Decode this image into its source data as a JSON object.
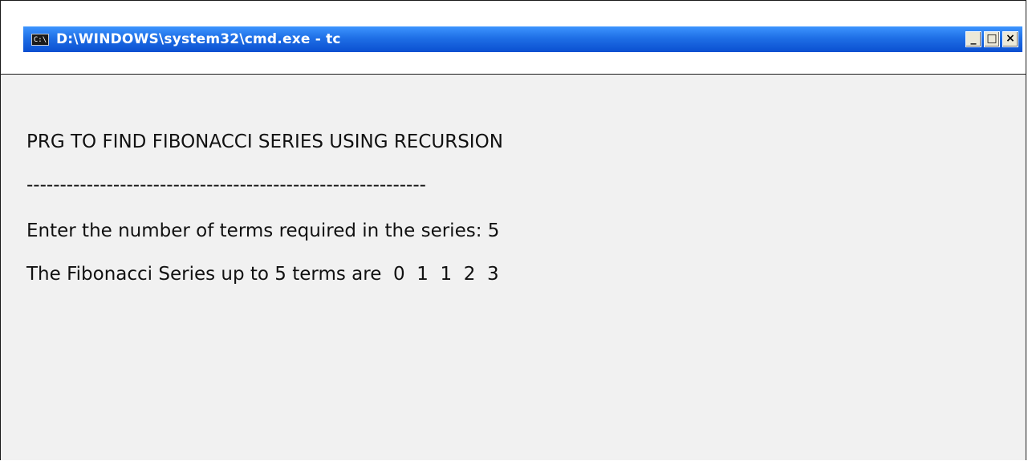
{
  "window": {
    "title": "D:\\WINDOWS\\system32\\cmd.exe - tc",
    "icon_label": "C:\\",
    "icon": "console-window-icon",
    "buttons": {
      "minimize": "_",
      "maximize": "□",
      "close": "×"
    }
  },
  "console": {
    "lines": [
      "PRG TO FIND FIBONACCI SERIES USING RECURSION",
      "------------------------------------------------------------",
      "Enter the number of terms required in the series: 5",
      "The Fibonacci Series up to 5 terms are  0  1  1  2  3"
    ]
  },
  "colors": {
    "titlebar": "#0a4fd0",
    "console_bg": "#f1f1f1",
    "text": "#111111"
  }
}
